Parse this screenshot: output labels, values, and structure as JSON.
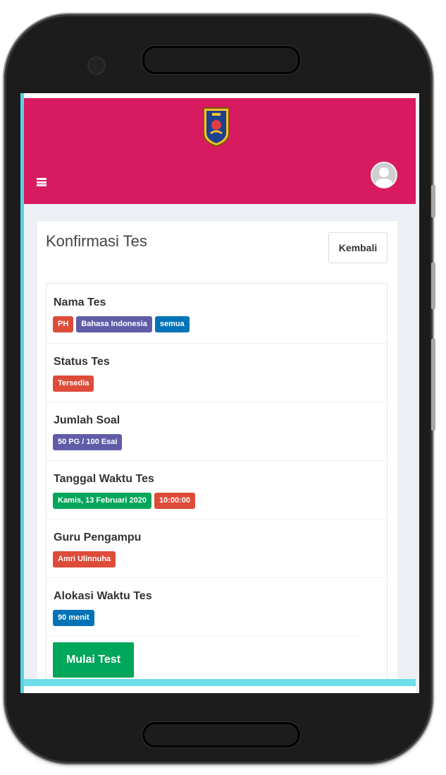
{
  "header": {
    "logo_icon": "school-crest-icon",
    "menu_icon": "hamburger-icon",
    "avatar_icon": "user-avatar-icon",
    "bar_color": "#d81b60"
  },
  "page": {
    "title": "Konfirmasi Tes",
    "back_label": "Kembali"
  },
  "details": [
    {
      "label": "Nama Tes",
      "badges": [
        {
          "text": "PH",
          "color": "red"
        },
        {
          "text": "Bahasa Indonesia",
          "color": "purple"
        },
        {
          "text": "semua",
          "color": "blue"
        }
      ]
    },
    {
      "label": "Status Tes",
      "badges": [
        {
          "text": "Tersedia",
          "color": "red"
        }
      ]
    },
    {
      "label": "Jumlah Soal",
      "badges": [
        {
          "text": "50 PG / 100 Esai",
          "color": "purple"
        }
      ]
    },
    {
      "label": "Tanggal Waktu Tes",
      "badges": [
        {
          "text": "Kamis, 13 Februari 2020",
          "color": "green"
        },
        {
          "text": "10:00:00",
          "color": "red"
        }
      ]
    },
    {
      "label": "Guru Pengampu",
      "badges": [
        {
          "text": "Amri Ulinnuha",
          "color": "red"
        }
      ]
    },
    {
      "label": "Alokasi Waktu Tes",
      "badges": [
        {
          "text": "90 menit",
          "color": "blue"
        }
      ]
    }
  ],
  "actions": {
    "start_label": "Mulai Test"
  },
  "colors": {
    "red": "#dd4b39",
    "purple": "#605ca8",
    "blue": "#0073b7",
    "green": "#00a65a"
  }
}
